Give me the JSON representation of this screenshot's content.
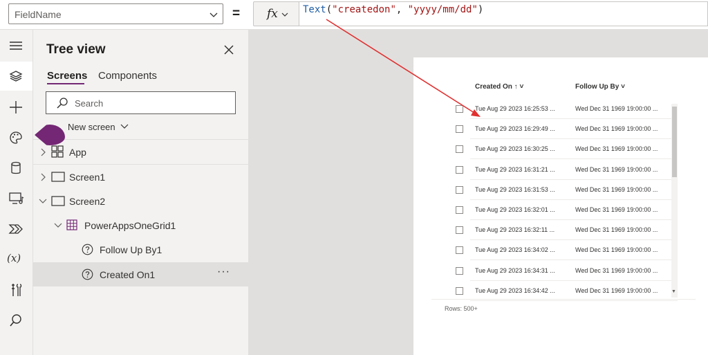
{
  "formula_bar": {
    "property_value": "FieldName",
    "equals": "=",
    "fx_label": "fx",
    "formula": {
      "fn": "Text",
      "open": "(",
      "arg1": "\"createdon\"",
      "comma": ", ",
      "arg2": "\"yyyy/mm/dd\"",
      "close": ")"
    }
  },
  "rail": {
    "icons": [
      "menu-icon",
      "layers-icon",
      "plus-icon",
      "palette-icon",
      "database-icon",
      "media-icon",
      "power-automate-icon",
      "variables-icon",
      "tools-icon",
      "search-icon"
    ],
    "variables_glyph": "(x)"
  },
  "tree": {
    "title": "Tree view",
    "tabs": [
      "Screens",
      "Components"
    ],
    "search_placeholder": "Search",
    "new_screen_label": "New screen",
    "items": [
      {
        "label": "App"
      },
      {
        "label": "Screen1"
      },
      {
        "label": "Screen2"
      },
      {
        "label": "PowerAppsOneGrid1"
      },
      {
        "label": "Follow Up By1"
      },
      {
        "label": "Created On1"
      }
    ],
    "more_label": "···"
  },
  "grid": {
    "columns": [
      "Created On ↑ ˅",
      "Follow Up By ˅"
    ],
    "rows": [
      [
        "Tue Aug 29 2023 16:25:53 ...",
        "Wed Dec 31 1969 19:00:00 ..."
      ],
      [
        "Tue Aug 29 2023 16:29:49 ...",
        "Wed Dec 31 1969 19:00:00 ..."
      ],
      [
        "Tue Aug 29 2023 16:30:25 ...",
        "Wed Dec 31 1969 19:00:00 ..."
      ],
      [
        "Tue Aug 29 2023 16:31:21 ...",
        "Wed Dec 31 1969 19:00:00 ..."
      ],
      [
        "Tue Aug 29 2023 16:31:53 ...",
        "Wed Dec 31 1969 19:00:00 ..."
      ],
      [
        "Tue Aug 29 2023 16:32:01 ...",
        "Wed Dec 31 1969 19:00:00 ..."
      ],
      [
        "Tue Aug 29 2023 16:32:11 ...",
        "Wed Dec 31 1969 19:00:00 ..."
      ],
      [
        "Tue Aug 29 2023 16:34:02 ...",
        "Wed Dec 31 1969 19:00:00 ..."
      ],
      [
        "Tue Aug 29 2023 16:34:31 ...",
        "Wed Dec 31 1969 19:00:00 ..."
      ],
      [
        "Tue Aug 29 2023 16:34:42 ...",
        "Wed Dec 31 1969 19:00:00 ..."
      ]
    ],
    "rows_count": "Rows: 500+"
  },
  "colors": {
    "accent": "#742774",
    "annotation_arrow": "#e03030",
    "formula_function": "#205da4",
    "formula_string": "#a31515"
  }
}
